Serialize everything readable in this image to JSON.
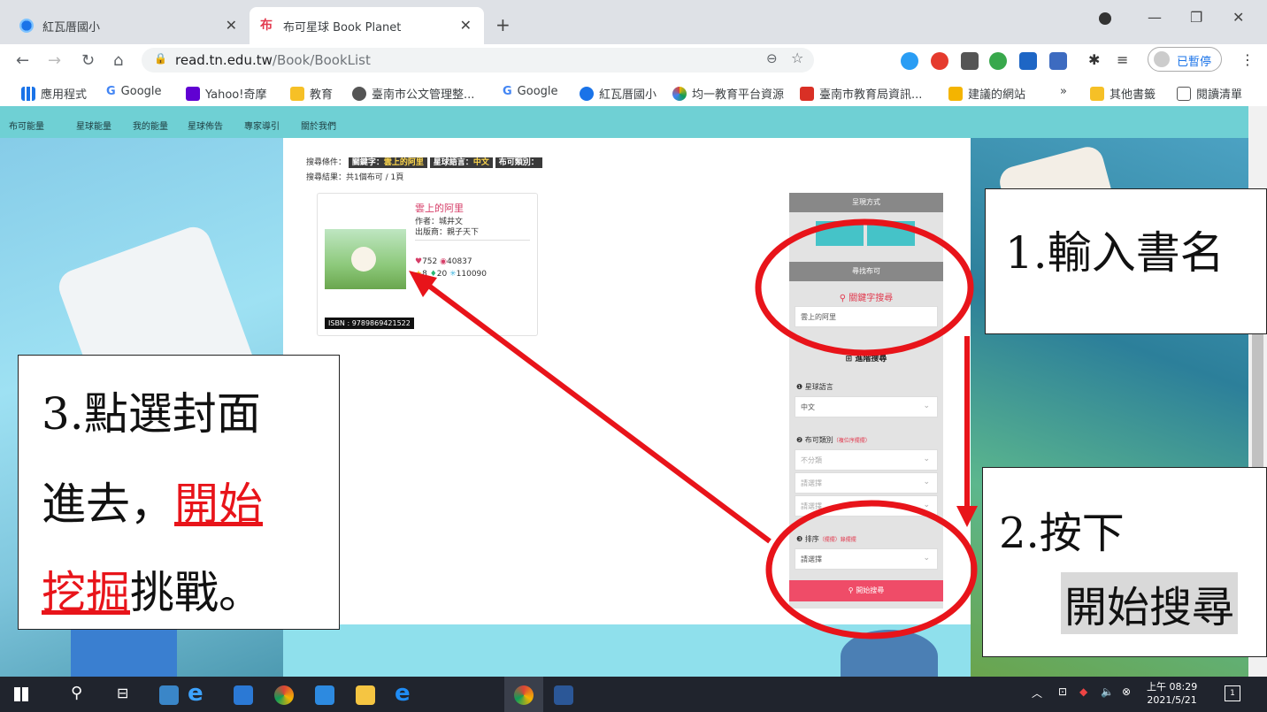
{
  "browser": {
    "tabs": [
      {
        "title": "紅瓦厝國小",
        "active": false
      },
      {
        "title": "布可星球 Book Planet",
        "active": true
      }
    ],
    "url_domain": "read.tn.edu.tw",
    "url_path": "/Book/BookList",
    "paused_label": "已暫停",
    "bookmarks": [
      "應用程式",
      "Google",
      "Yahoo!奇摩",
      "教育",
      "臺南市公文管理整...",
      "Google",
      "紅瓦厝國小",
      "均一教育平台資源",
      "臺南市教育局資訊...",
      "建議的網站",
      "»",
      "其他書籤",
      "閱讀清單"
    ]
  },
  "site": {
    "nav": [
      "布可能量",
      "星球能量",
      "我的能量",
      "星球佈告",
      "專家導引",
      "關於我們"
    ],
    "search_conditions_label": "搜尋條件：",
    "tag_keyword_label": "關鍵字：",
    "tag_keyword_value": "雲上的阿里",
    "tag_lang_label": "星球語言：",
    "tag_lang_value": "中文",
    "tag_category_label": "布可類別：",
    "result_line": "搜尋結果：共1個布可 / 1頁",
    "book": {
      "title": "雲上的阿里",
      "author": "作者：城井文",
      "publisher": "出版商：親子天下",
      "likes": "752",
      "views": "40837",
      "stars": "8",
      "drops": "20",
      "points": "110090",
      "isbn": "ISBN : 9789869421522"
    },
    "panel": {
      "display_mode": "呈現方式",
      "find_book": "尋找布可",
      "keyword_search": "關鍵字搜尋",
      "keyword_value": "雲上的阿里",
      "advanced": "進階搜尋",
      "lang_label": "星球語言",
      "lang_value": "中文",
      "category_label": "布可類別",
      "category_note": "（複位序擺擺）",
      "category_value": "不分類",
      "select_placeholder": "請選擇",
      "sort_label": "排序",
      "sort_note": "（擺擺）錄擺擺",
      "search_button": "開始搜尋"
    }
  },
  "callouts": {
    "c1": "1.輸入書名",
    "c2_line1": "2.按下",
    "c2_line2": "開始搜尋",
    "c3_line1": "3.點選封面",
    "c3_line2a": "進去，",
    "c3_line2b": "開始",
    "c3_line3a": "挖掘",
    "c3_line3b": "挑戰。"
  },
  "taskbar": {
    "time": "上午 08:29",
    "date": "2021/5/21",
    "notif_count": "1"
  },
  "colors": {
    "annotation_red": "#e8141a",
    "site_teal": "#6fd0d4",
    "search_pink": "#ef4c68"
  }
}
